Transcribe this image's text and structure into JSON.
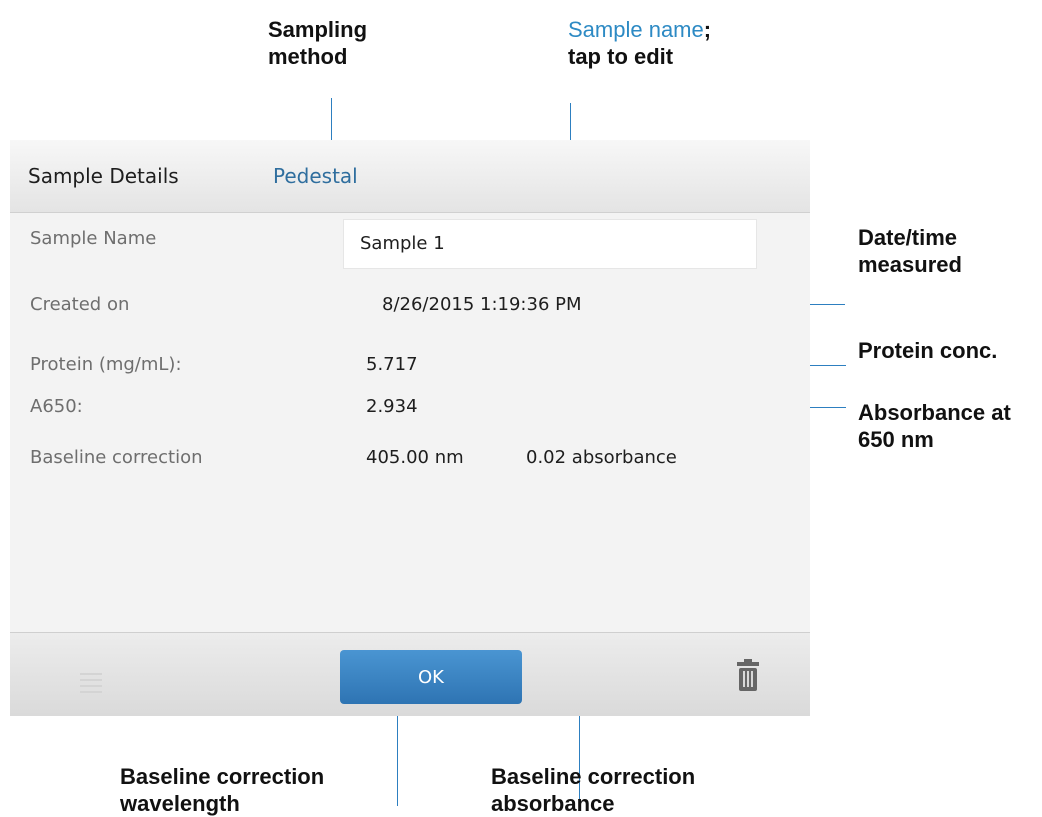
{
  "callouts": {
    "sampling_method_line1": "Sampling",
    "sampling_method_line2": "method",
    "sample_name_blue": "Sample name",
    "sample_name_semicolon": ";",
    "sample_name_line2": "tap to edit",
    "datetime_line1": "Date/time",
    "datetime_line2": "measured",
    "protein_conc": "Protein conc.",
    "absorbance_line1": "Absorbance at",
    "absorbance_line2": "650 nm",
    "baseline_wl_line1": "Baseline correction",
    "baseline_wl_line2": "wavelength",
    "baseline_abs_line1": "Baseline correction",
    "baseline_abs_line2": "absorbance"
  },
  "header": {
    "title": "Sample Details",
    "method": "Pedestal"
  },
  "fields": {
    "sample_name_label": "Sample Name",
    "sample_name_value": "Sample 1",
    "created_label": "Created on",
    "created_value": "8/26/2015 1:19:36 PM",
    "protein_label": "Protein (mg/mL):",
    "protein_value": "5.717",
    "a650_label": "A650:",
    "a650_value": "2.934",
    "baseline_label": "Baseline correction",
    "baseline_nm_value": "405.00 nm",
    "baseline_abs_value": "0.02 absorbance"
  },
  "footer": {
    "ok_label": "OK"
  },
  "icons": {
    "menu": "menu-icon",
    "trash": "trash-icon"
  },
  "colors": {
    "accent_blue": "#2d7fc0",
    "button_blue": "#3a84c4",
    "method_text": "#2f6e9e"
  }
}
